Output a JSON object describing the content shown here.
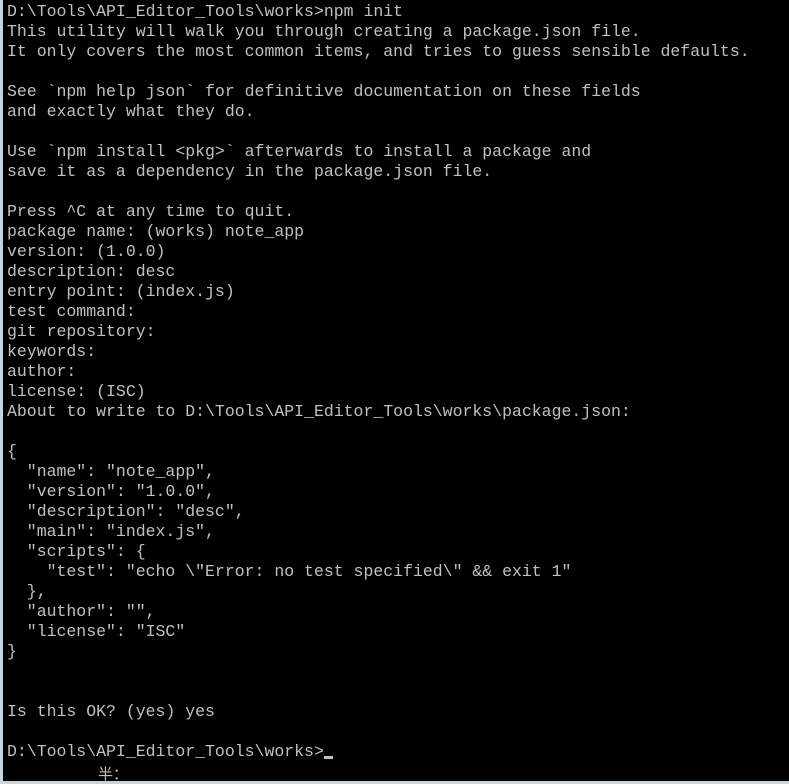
{
  "terminal": {
    "lines": [
      "D:\\Tools\\API_Editor_Tools\\works>npm init",
      "This utility will walk you through creating a package.json file.",
      "It only covers the most common items, and tries to guess sensible defaults.",
      "",
      "See `npm help json` for definitive documentation on these fields",
      "and exactly what they do.",
      "",
      "Use `npm install <pkg>` afterwards to install a package and",
      "save it as a dependency in the package.json file.",
      "",
      "Press ^C at any time to quit.",
      "package name: (works) note_app",
      "version: (1.0.0)",
      "description: desc",
      "entry point: (index.js)",
      "test command:",
      "git repository:",
      "keywords:",
      "author:",
      "license: (ISC)",
      "About to write to D:\\Tools\\API_Editor_Tools\\works\\package.json:",
      "",
      "{",
      "  \"name\": \"note_app\",",
      "  \"version\": \"1.0.0\",",
      "  \"description\": \"desc\",",
      "  \"main\": \"index.js\",",
      "  \"scripts\": {",
      "    \"test\": \"echo \\\"Error: no test specified\\\" && exit 1\"",
      "  },",
      "  \"author\": \"\",",
      "  \"license\": \"ISC\"",
      "}",
      "",
      "",
      "Is this OK? (yes) yes",
      ""
    ],
    "prompt": "D:\\Tools\\API_Editor_Tools\\works>",
    "ime_indicator": "半："
  }
}
